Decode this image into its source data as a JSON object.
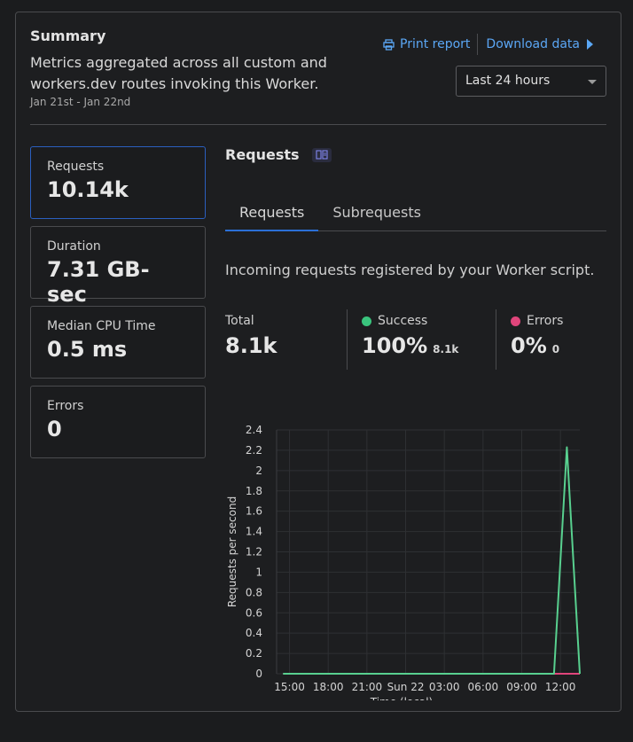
{
  "summary": {
    "title": "Summary",
    "description": "Metrics aggregated across all custom and workers.dev routes invoking this Worker.",
    "date_range": "Jan 21st - Jan 22nd"
  },
  "actions": {
    "print_label": "Print report",
    "download_label": "Download data",
    "link_color": "#5ba7f5"
  },
  "time_select": {
    "selected": "Last 24 hours"
  },
  "stats": [
    {
      "label": "Requests",
      "value": "10.14k"
    },
    {
      "label": "Duration",
      "value": "7.31 GB-sec"
    },
    {
      "label": "Median CPU Time",
      "value": "0.5 ms"
    },
    {
      "label": "Errors",
      "value": "0"
    }
  ],
  "panel": {
    "title": "Requests",
    "tabs": [
      "Requests",
      "Subrequests"
    ],
    "active_tab": "Requests",
    "intro": "Incoming requests registered by your Worker script."
  },
  "metrics": {
    "total": {
      "label": "Total",
      "value": "8.1k"
    },
    "success": {
      "label": "Success",
      "value": "100%",
      "sub": "8.1k",
      "color": "#3ac47d"
    },
    "errors": {
      "label": "Errors",
      "value": "0%",
      "sub": "0",
      "color": "#e0457b"
    }
  },
  "chart_data": {
    "type": "line",
    "xlabel": "Time (local)",
    "ylabel": "Requests per second",
    "ylim": [
      0,
      2.4
    ],
    "y_ticks": [
      "0",
      "0.2",
      "0.4",
      "0.6",
      "0.8",
      "1",
      "1.2",
      "1.4",
      "1.6",
      "1.8",
      "2",
      "2.2",
      "2.4"
    ],
    "x_ticks": [
      "15:00",
      "18:00",
      "21:00",
      "Sun 22",
      "03:00",
      "06:00",
      "09:00",
      "12:00"
    ],
    "x_range_hours": [
      14,
      13.5
    ],
    "grid": true,
    "series": [
      {
        "name": "Success",
        "color": "#58d08f",
        "x": [
          "13:00",
          "11:00",
          "12:00",
          "13:00"
        ],
        "points": [
          [
            0,
            0
          ],
          [
            21,
            0
          ],
          [
            22,
            2.23
          ],
          [
            23,
            0
          ]
        ]
      },
      {
        "name": "Errors",
        "color": "#e0457b",
        "points": [
          [
            0,
            0
          ],
          [
            23,
            0
          ]
        ]
      }
    ]
  }
}
